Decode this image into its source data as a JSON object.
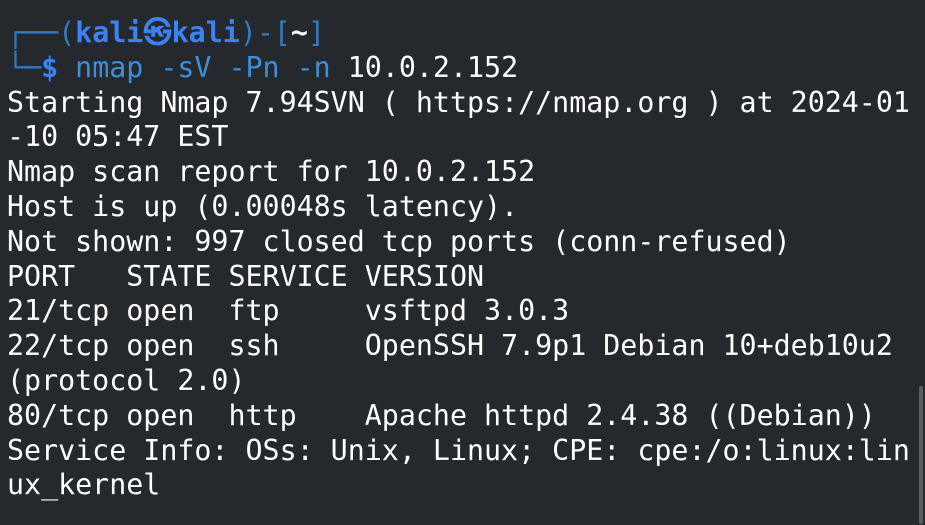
{
  "prompt": {
    "open": "┌──(",
    "user": "kali",
    "sep": "㉿",
    "host": "kali",
    "close_path_open": ")-[",
    "path": "~",
    "close": "]",
    "second_frame": "└─",
    "dollar": "$",
    "command": " nmap -sV -Pn -n ",
    "target": "10.0.2.152"
  },
  "output": [
    "Starting Nmap 7.94SVN ( https://nmap.org ) at 2024-01",
    "-10 05:47 EST",
    "Nmap scan report for 10.0.2.152",
    "Host is up (0.00048s latency).",
    "Not shown: 997 closed tcp ports (conn-refused)",
    "PORT   STATE SERVICE VERSION",
    "21/tcp open  ftp     vsftpd 3.0.3",
    "22/tcp open  ssh     OpenSSH 7.9p1 Debian 10+deb10u2",
    "(protocol 2.0)",
    "80/tcp open  http    Apache httpd 2.4.38 ((Debian))",
    "Service Info: OSs: Unix, Linux; CPE: cpe:/o:linux:lin",
    "ux_kernel"
  ],
  "colors": {
    "background": "#25292e",
    "prompt_blue": "#3b82f6",
    "frame_blue": "#2f7cc2",
    "text": "#ffffff"
  }
}
